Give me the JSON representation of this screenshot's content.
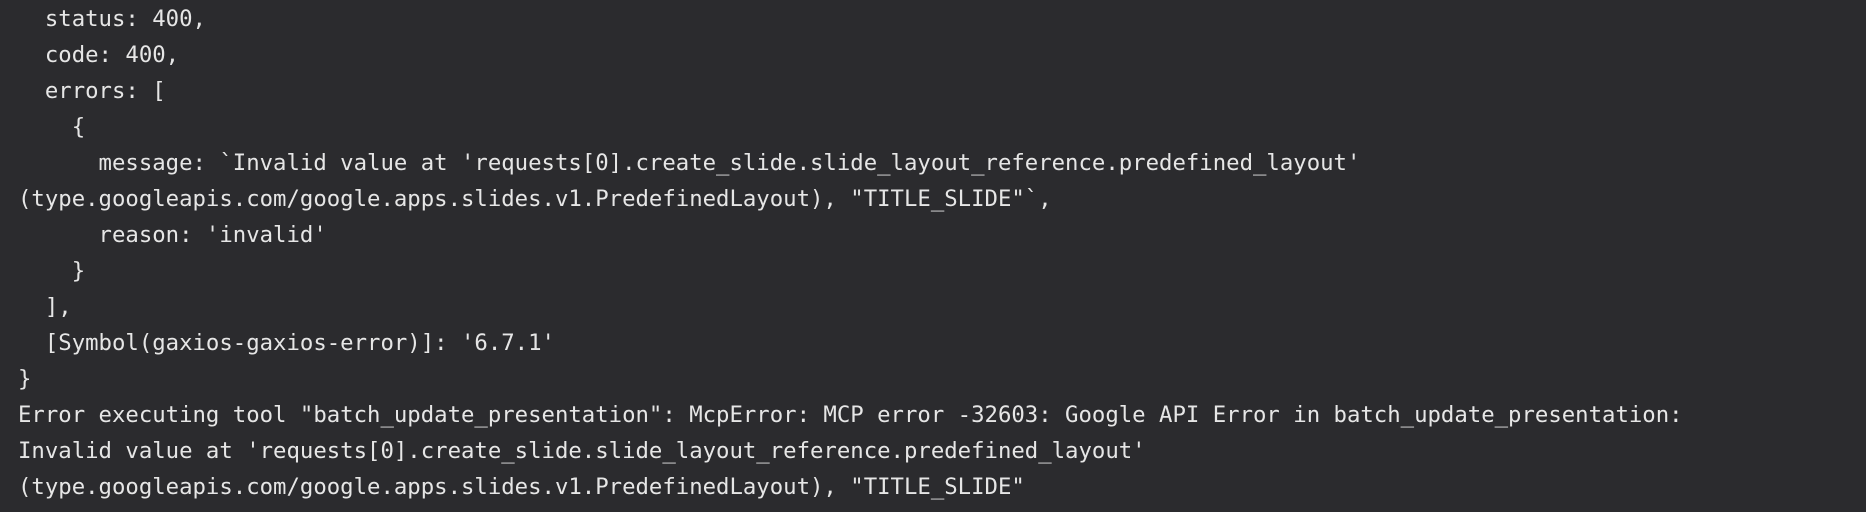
{
  "terminal": {
    "lines": [
      "  status: 400,",
      "  code: 400,",
      "  errors: [",
      "    {",
      "      message: `Invalid value at 'requests[0].create_slide.slide_layout_reference.predefined_layout'",
      "(type.googleapis.com/google.apps.slides.v1.PredefinedLayout), \"TITLE_SLIDE\"`,",
      "      reason: 'invalid'",
      "    }",
      "  ],",
      "  [Symbol(gaxios-gaxios-error)]: '6.7.1'",
      "}",
      "Error executing tool \"batch_update_presentation\": McpError: MCP error -32603: Google API Error in batch_update_presentation:",
      "Invalid value at 'requests[0].create_slide.slide_layout_reference.predefined_layout'",
      "(type.googleapis.com/google.apps.slides.v1.PredefinedLayout), \"TITLE_SLIDE\""
    ]
  }
}
